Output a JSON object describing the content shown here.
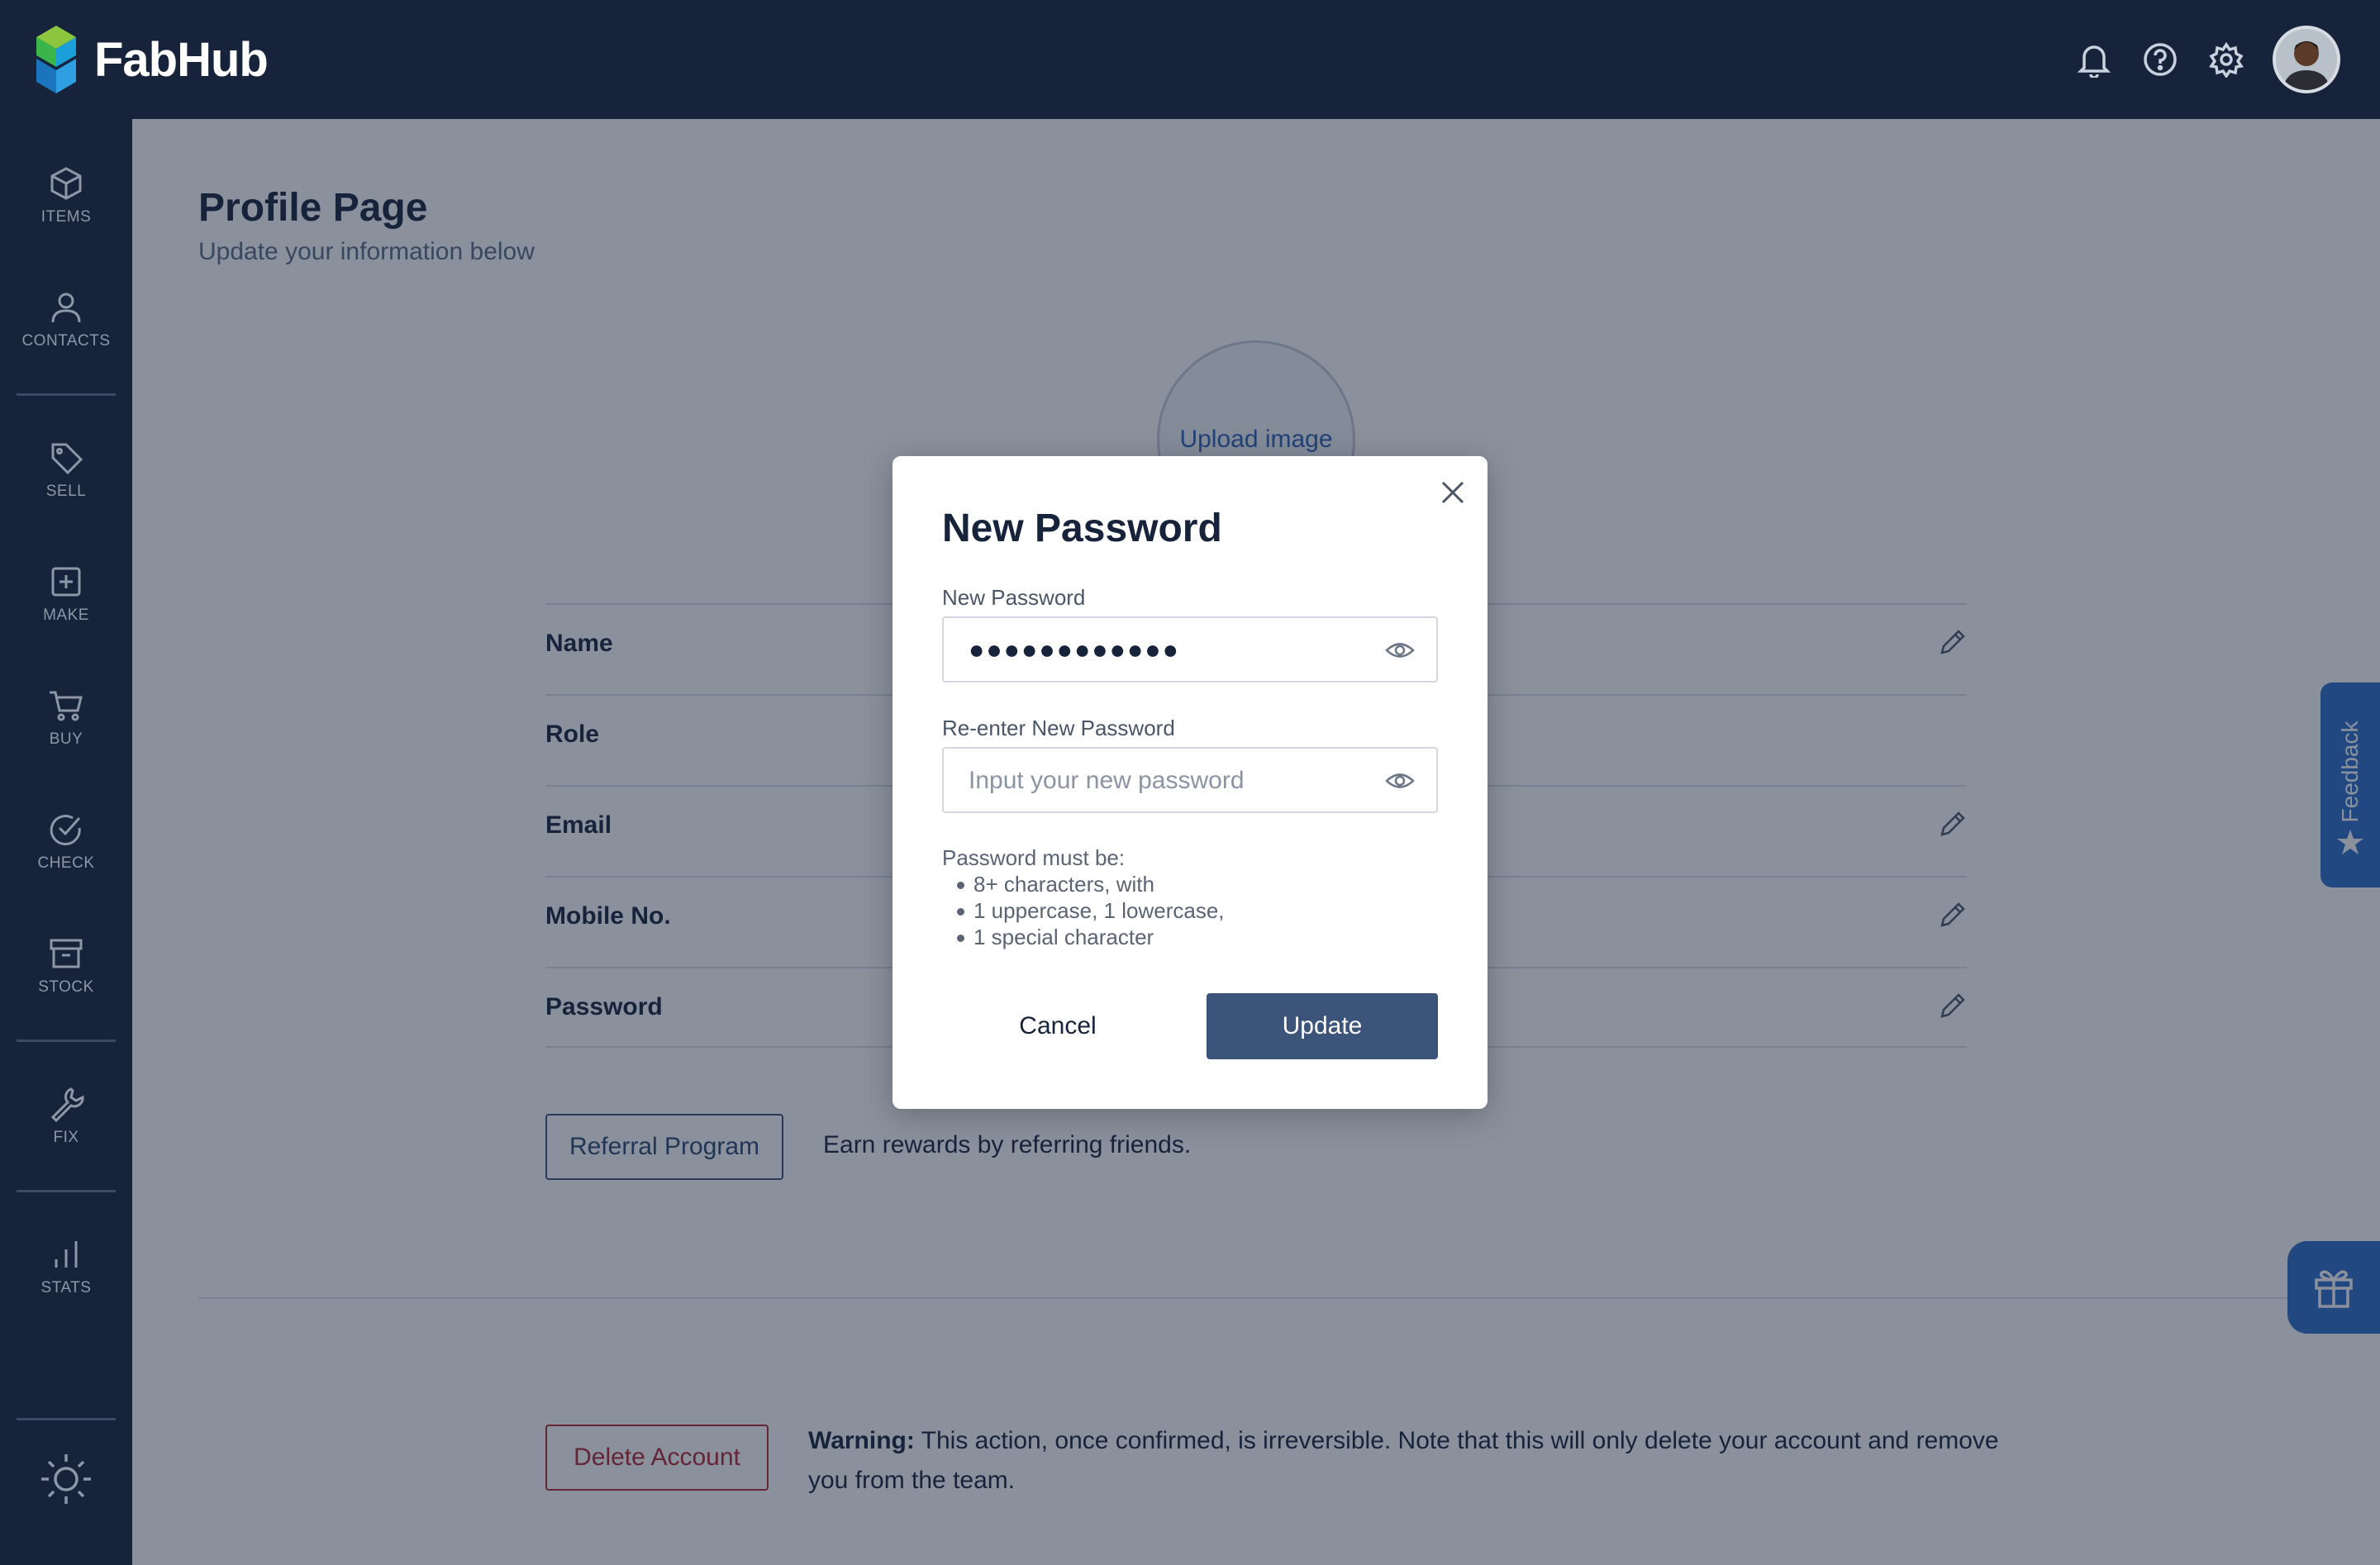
{
  "app": {
    "name": "FabHub"
  },
  "topbar": {
    "icons": [
      "bell-icon",
      "help-icon",
      "gear-icon"
    ]
  },
  "sidebar": {
    "items": [
      {
        "label": "ITEMS",
        "icon": "box-icon"
      },
      {
        "label": "CONTACTS",
        "icon": "person-icon"
      },
      {
        "label": "SELL",
        "icon": "tag-icon"
      },
      {
        "label": "MAKE",
        "icon": "plus-square-icon"
      },
      {
        "label": "BUY",
        "icon": "cart-icon"
      },
      {
        "label": "CHECK",
        "icon": "check-circle-icon"
      },
      {
        "label": "STOCK",
        "icon": "archive-icon"
      },
      {
        "label": "FIX",
        "icon": "wrench-icon"
      },
      {
        "label": "STATS",
        "icon": "bar-chart-icon"
      }
    ],
    "footer_icon": "sun-icon"
  },
  "page": {
    "title": "Profile Page",
    "subtitle": "Update your information below",
    "upload_label": "Upload image",
    "fields": [
      {
        "label": "Name",
        "editable": true
      },
      {
        "label": "Role",
        "editable": false
      },
      {
        "label": "Email",
        "editable": true
      },
      {
        "label": "Mobile No.",
        "editable": true
      },
      {
        "label": "Password",
        "editable": true
      }
    ],
    "referral_button": "Referral Program",
    "referral_text": "Earn rewards by referring friends.",
    "delete_button": "Delete Account",
    "warning_bold": "Warning:",
    "warning_text": " This action, once confirmed, is irreversible. Note that this will only delete your account and remove you from the team.",
    "feedback_label": "Feedback"
  },
  "modal": {
    "title": "New Password",
    "field1_label": "New Password",
    "field1_value": "●●●●●●●●●●●●",
    "field2_label": "Re-enter New Password",
    "field2_placeholder": "Input your new password",
    "rules_title": "Password must be:",
    "rules": [
      "8+ characters, with",
      "1 uppercase, 1 lowercase,",
      "1 special character"
    ],
    "cancel_label": "Cancel",
    "update_label": "Update"
  },
  "colors": {
    "navy": "#16233b",
    "accent_blue": "#2d6cc4",
    "update_button": "#3c5479",
    "danger": "#b3262e"
  }
}
